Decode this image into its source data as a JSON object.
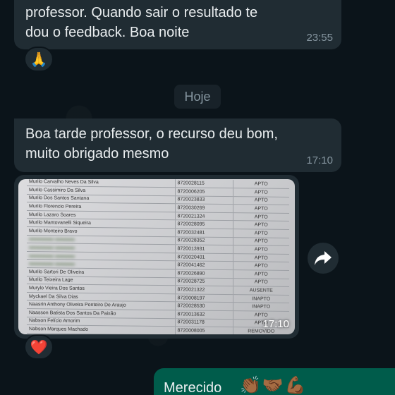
{
  "messages": [
    {
      "direction": "incoming",
      "lines": [
        "professor. Quando sair o resultado te",
        "dou o feedback. Boa noite"
      ],
      "time": "23:55",
      "reaction": "🙏"
    },
    {
      "day_chip": "Hoje"
    },
    {
      "direction": "incoming",
      "lines": [
        "Boa tarde professor, o recurso deu bom,",
        "muito obrigado mesmo"
      ],
      "time": "17:10"
    },
    {
      "direction": "incoming",
      "type": "image",
      "time": "17:10",
      "reaction": "❤️",
      "document_rows": [
        [
          "Murilo Carvalho Neves Da Silva",
          "8720028115",
          "APTO"
        ],
        [
          "Murilo Cassimiro Da Silva",
          "8720006205",
          "APTO"
        ],
        [
          "Murilo Dos Santos Santana",
          "8720023833",
          "APTO"
        ],
        [
          "Murilo Florencio Pereira",
          "8720030269",
          "APTO"
        ],
        [
          "Murilo Lazaro Soares",
          "8720021324",
          "APTO"
        ],
        [
          "Murilo Mantovanelli Siqueira",
          "8720028095",
          "APTO"
        ],
        [
          "Murilo Monteiro Bravo",
          "8720032481",
          "APTO"
        ],
        [
          "",
          "8720028352",
          "APTO"
        ],
        [
          "",
          "8720013931",
          "APTO"
        ],
        [
          "",
          "8720020401",
          "APTO"
        ],
        [
          "",
          "8720041462",
          "APTO"
        ],
        [
          "Murilo Sartori De Oliveira",
          "8720026890",
          "APTO"
        ],
        [
          "Murilo Teixeira Lage",
          "8720028725",
          "APTO"
        ],
        [
          "Murylo Vieira Dos Santos",
          "8720021322",
          "AUSENTE"
        ],
        [
          "Myckael Da Silva Dias",
          "8720008197",
          "INAPTO"
        ],
        [
          "Naasrin Anthony Oliveira Ponteiro De Araujo",
          "8720028530",
          "INAPTO"
        ],
        [
          "Naasson Batista Dos Santos Da Paixão",
          "8720013632",
          "APTO"
        ],
        [
          "Nabson Felício Amorim",
          "8720031178",
          "APTO"
        ],
        [
          "Nabson Marques Machado",
          "8720008005",
          "REMOVIDO"
        ]
      ]
    },
    {
      "direction": "outgoing",
      "text": "Merecido",
      "emojis": "👏🏾🤝🏾💪🏾"
    }
  ],
  "icons": {
    "forward": "forward-arrow-icon"
  },
  "colors": {
    "background": "#0b141a",
    "bubble_incoming": "#202c33",
    "bubble_outgoing": "#005c4b",
    "meta_text": "#8696a0"
  }
}
